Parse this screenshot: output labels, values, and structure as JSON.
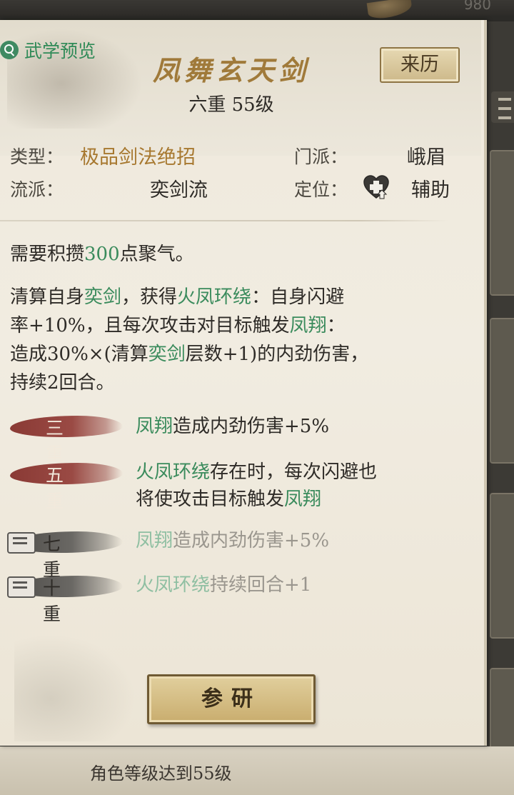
{
  "topbar": {
    "number": "980"
  },
  "tab": {
    "label": "武学预览",
    "icon": "magnifier-icon"
  },
  "skill": {
    "name": "凤舞玄天剑",
    "origin_button": "来历",
    "level": "六重 55级"
  },
  "info": {
    "type_label": "类型：",
    "type_value": "极品剑法绝招",
    "sect_label": "门派：",
    "sect_value": "峨眉",
    "school_label": "流派：",
    "school_value": "奕剑流",
    "role_label": "定位：",
    "role_icon": "heart-plus-icon",
    "role_value": "辅助"
  },
  "description": {
    "line1": {
      "a": "需要积攒",
      "b": "300",
      "c": "点聚气。"
    },
    "para": {
      "p1": "清算自身",
      "p2": "奕剑",
      "p3": "，获得",
      "p4": "火凤环绕",
      "p5": "：自身闪避",
      "p6": "率+10%，且每次攻击对目标触发",
      "p7": "凤翔",
      "p8": "：",
      "p9": "造成30%×(清算",
      "p10": "奕剑",
      "p11": "层数+1)的内劲伤害，",
      "p12": "持续2回合。"
    }
  },
  "tiers": [
    {
      "label": "三重",
      "unlocked": true,
      "k": "凤翔",
      "rest": "造成内劲伤害+5%"
    },
    {
      "label": "五重",
      "unlocked": true,
      "k": "火凤环绕",
      "rest": "存在时，每次闪避也",
      "line2a": "将使攻击目标触发",
      "line2b": "凤翔"
    },
    {
      "label": "七重",
      "unlocked": false,
      "k": "凤翔",
      "rest": "造成内劲伤害+5%"
    },
    {
      "label": "十重",
      "unlocked": false,
      "k": "火凤环绕",
      "rest": "持续回合+1"
    }
  ],
  "research_button": "参研",
  "footer": {
    "requirement": "角色等级达到55级"
  },
  "colors": {
    "green": "#3a8b5c",
    "gold": "#a7782f",
    "tier_red": "#8a3a35",
    "tier_gray": "#5a5855"
  }
}
